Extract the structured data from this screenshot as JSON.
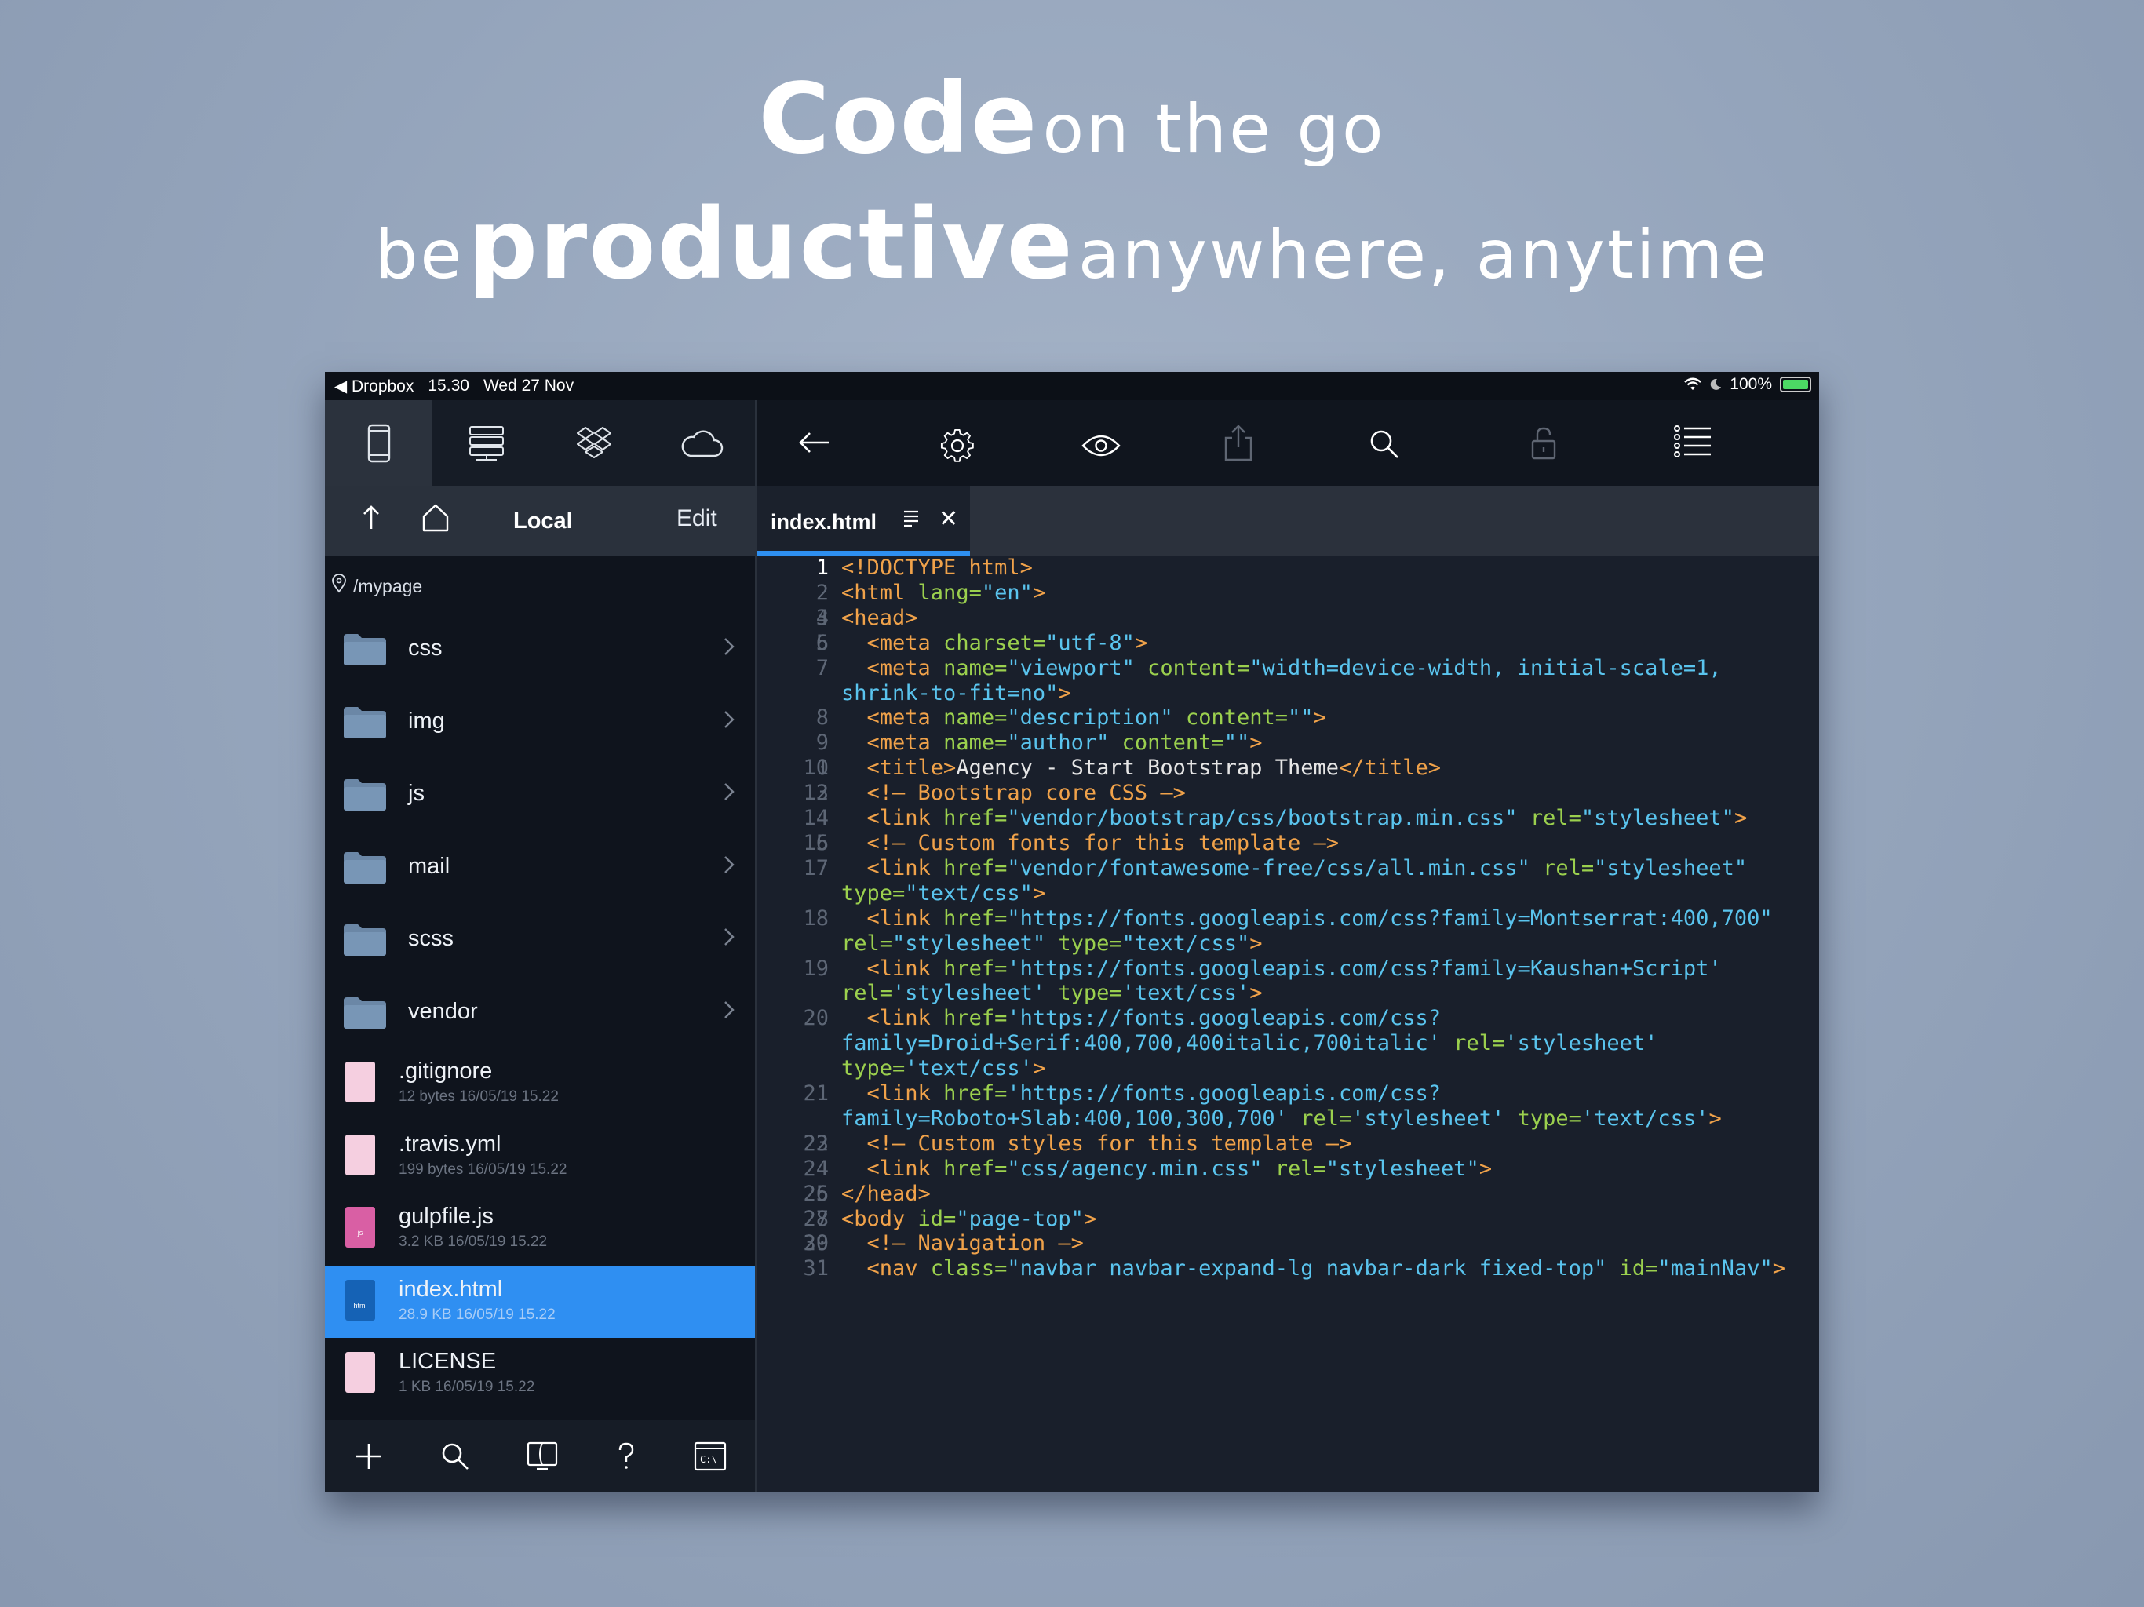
{
  "headline": {
    "line1_bold": "Code",
    "line1_light": "on the go",
    "line2_pre": "be",
    "line2_bold": "productive",
    "line2_post": "anywhere, anytime"
  },
  "status_bar": {
    "back_app": "◀ Dropbox",
    "time": "15.30",
    "date": "Wed 27 Nov",
    "battery": "100%"
  },
  "left_panel": {
    "nav_title": "Local",
    "edit_label": "Edit",
    "path": "/mypage",
    "folders": [
      {
        "name": "css"
      },
      {
        "name": "img"
      },
      {
        "name": "js"
      },
      {
        "name": "mail"
      },
      {
        "name": "scss"
      },
      {
        "name": "vendor"
      }
    ],
    "files": [
      {
        "name": ".gitignore",
        "meta": "12 bytes 16/05/19 15.22",
        "type": ""
      },
      {
        "name": ".travis.yml",
        "meta": "199 bytes 16/05/19 15.22",
        "type": ""
      },
      {
        "name": "gulpfile.js",
        "meta": "3.2 KB 16/05/19 15.22",
        "type": "js"
      },
      {
        "name": "index.html",
        "meta": "28.9 KB 16/05/19 15.22",
        "type": "html"
      },
      {
        "name": "LICENSE",
        "meta": "1 KB 16/05/19 15.22",
        "type": ""
      }
    ]
  },
  "editor": {
    "tab_name": "index.html",
    "close_glyph": "✕"
  },
  "colors": {
    "selected_row": "#2f8ff2",
    "tag": "#f0a24a",
    "attr": "#9bd04e",
    "string": "#5ac4ee"
  }
}
